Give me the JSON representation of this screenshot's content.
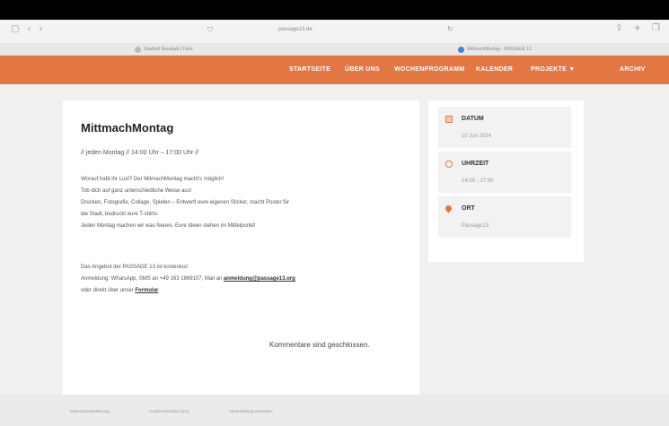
{
  "browser": {
    "url": "passage13.de",
    "tabs": [
      {
        "label": "Stadtteil Neustadt | Funk"
      },
      {
        "label": "MittmachMontag - PASSAGE 13"
      }
    ]
  },
  "nav": {
    "items": [
      "STARTSEITE",
      "ÜBER UNS",
      "WOCHENPROGRAMM",
      "KALENDER",
      "PROJEKTE ▼",
      "ARCHIV"
    ]
  },
  "post": {
    "title": "MittmachMontag",
    "subtitle": "// jeden Montag // 14:00 Uhr – 17:00 Uhr //",
    "para1": [
      "Worauf habt ihr Lust? Der MitmachMontag macht’s möglich!",
      "Tob dich auf ganz unterschiedliche Weise aus!",
      "Drucken, Fotografie, Collage, Spielen – Entwerft eure eigenen Sticker, macht Poster für",
      "die Stadt, bedruckt eure T-shirts.",
      "Jeden Montag machen wir was Neues. Eure Ideen stehen im Mittelpunkt!"
    ],
    "para2_line1": "Das Angebot der PASSAGE 13 ist kostenlos!",
    "para2_line2_prefix": "Anmeldung: WhatsApp, SMS an +49 163 1869107, Mail an ",
    "email": "anmeldung@passage13.org",
    "para2_line3_prefix": "oder direkt über unser ",
    "form_link": "Formular"
  },
  "comments_closed": "Kommentare sind geschlossen.",
  "event": {
    "date_label": "DATUM",
    "date_value": "10 Jun 2024",
    "time_label": "UHRZEIT",
    "time_value": "14:00 - 17:00",
    "place_label": "ORT",
    "place_value": "Passage13"
  },
  "footer": {
    "links": [
      "Datenschutzerklärung",
      "Cookie-Richtlinie (EU)",
      "Veranstaltung anmelden"
    ]
  },
  "colors": {
    "accent": "#e27744"
  }
}
